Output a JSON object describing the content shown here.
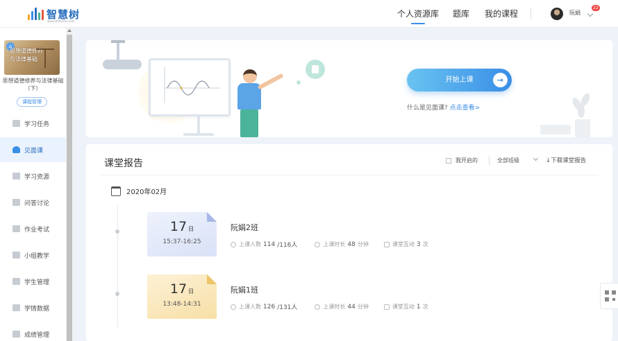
{
  "header": {
    "logo_text": "智慧树",
    "logo_sub": "www.zhihuishu.com",
    "nav": [
      {
        "label": "个人资源库",
        "active": true
      },
      {
        "label": "题库",
        "active": false
      },
      {
        "label": "我的课程",
        "active": false
      }
    ],
    "user_name": "阮娟",
    "notification_count": "22"
  },
  "sidebar": {
    "course_thumb_title": "思想道德修养与法律基础",
    "course_name": "思想道德修养与法律基础（下）",
    "manage_label": "课程管理",
    "items": [
      {
        "label": "学习任务",
        "icon": "task-icon"
      },
      {
        "label": "见面课",
        "icon": "user-icon",
        "active": true
      },
      {
        "label": "学习资源",
        "icon": "resource-icon"
      },
      {
        "label": "问答讨论",
        "icon": "discussion-icon"
      },
      {
        "label": "作业考试",
        "icon": "exam-icon"
      },
      {
        "label": "小组教学",
        "icon": "group-icon"
      },
      {
        "label": "学生管理",
        "icon": "student-icon"
      },
      {
        "label": "学情数据",
        "icon": "chart-icon"
      },
      {
        "label": "成绩管理",
        "icon": "grade-icon"
      }
    ]
  },
  "banner": {
    "start_label": "开始上课",
    "faq_text": "什么是见面课?",
    "faq_link": "点击查看>"
  },
  "report": {
    "title": "课堂报告",
    "filter_mine": "我开启的",
    "filter_class": "全部班级",
    "download_label": "下载课堂报告",
    "month": "2020年02月",
    "sessions": [
      {
        "day": "17",
        "day_unit": "日",
        "time": "15:37-16:25",
        "class_name": "阮娟2班",
        "attend_label": "上课人数",
        "attend_value": "114",
        "attend_total": "/116人",
        "duration_label": "上课时长",
        "duration_value": "48",
        "duration_unit": "分钟",
        "interact_label": "课堂互动",
        "interact_value": "3",
        "interact_unit": "次",
        "color": "blue"
      },
      {
        "day": "17",
        "day_unit": "日",
        "time": "13:48-14:31",
        "class_name": "阮娟1班",
        "attend_label": "上课人数",
        "attend_value": "126",
        "attend_total": "/131人",
        "duration_label": "上课时长",
        "duration_value": "44",
        "duration_unit": "分钟",
        "interact_label": "课堂互动",
        "interact_value": "1",
        "interact_unit": "次",
        "color": "yellow"
      }
    ]
  },
  "colors": {
    "accent": "#3a8ee6",
    "background": "#eef3f9"
  }
}
